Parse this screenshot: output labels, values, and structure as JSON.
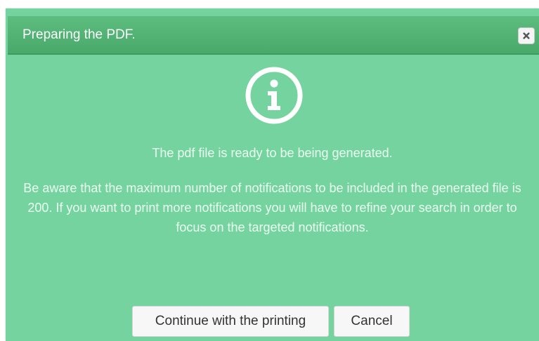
{
  "dialog": {
    "title": "Preparing the PDF.",
    "close_icon": "close-icon",
    "info_icon": "info-icon",
    "message_ready": "The pdf file is ready to be being generated.",
    "message_warning": "Be aware that the maximum number of notifications to be included in the generated file is 200. If you want to print more notifications you will have to refine your search in order to focus on the targeted notifications.",
    "buttons": {
      "continue_label": "Continue with the printing",
      "cancel_label": "Cancel"
    }
  },
  "colors": {
    "dialog_bg": "#74d39e",
    "titlebar_bg": "#4fae70",
    "text_light": "#eafff2"
  }
}
